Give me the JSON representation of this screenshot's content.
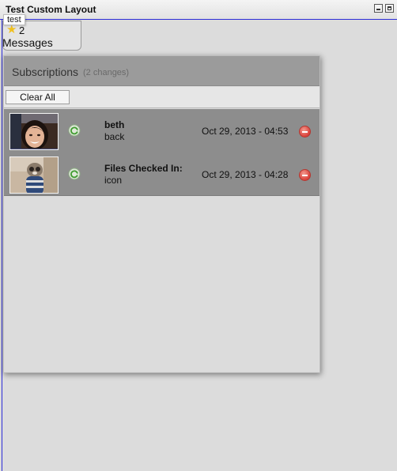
{
  "window": {
    "title": "Test Custom Layout"
  },
  "messages": {
    "tooltip": "test",
    "count": "2",
    "label": "Messages",
    "icon": "star-icon"
  },
  "subscriptions": {
    "title": "Subscriptions",
    "changes": "(2 changes)",
    "clear_all_label": "Clear All",
    "items": [
      {
        "title": "beth",
        "subtitle": "back",
        "date": "Oct 29, 2013 - 04:53",
        "thumbnail": "woman-photo",
        "action_icon": "refresh-icon",
        "remove_icon": "remove-icon"
      },
      {
        "title": "Files Checked In:",
        "subtitle": "icon",
        "date": "Oct 29, 2013 - 04:28",
        "thumbnail": "plush-toy-photo",
        "action_icon": "refresh-icon",
        "remove_icon": "remove-icon"
      }
    ]
  },
  "colors": {
    "accent": "#2d2dd8",
    "header": "#9b9b9b",
    "list_bg": "#8d8d8d",
    "remove": "#d9413a",
    "refresh": "#4caf3a"
  }
}
